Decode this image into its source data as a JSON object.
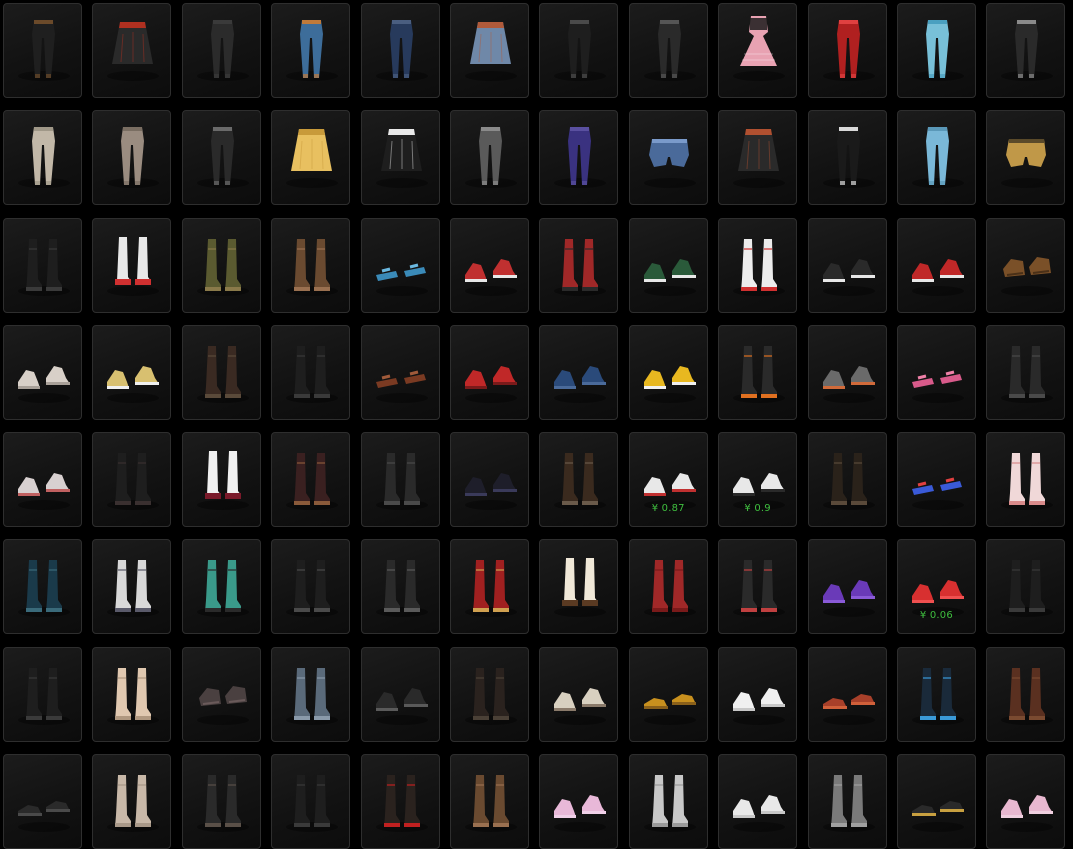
{
  "items": [
    {
      "name": "pants",
      "color": "#1f1f1f",
      "accent": "#6b4a2a"
    },
    {
      "name": "skirt",
      "color": "#2a2a2a",
      "accent": "#b03020"
    },
    {
      "name": "pants",
      "color": "#2b2b2b",
      "accent": "#3a3a3a"
    },
    {
      "name": "pants",
      "color": "#3d6d9a",
      "accent": "#c07a3a"
    },
    {
      "name": "pants",
      "color": "#273a5c",
      "accent": "#4a5e80"
    },
    {
      "name": "skirt",
      "color": "#6f88a8",
      "accent": "#b05a3a"
    },
    {
      "name": "pants",
      "color": "#1e1e1e",
      "accent": "#4a4a4a"
    },
    {
      "name": "pants",
      "color": "#2a2a2a",
      "accent": "#555555"
    },
    {
      "name": "dress",
      "color": "#e8a2b2",
      "accent": "#1c1c1c"
    },
    {
      "name": "pants",
      "color": "#b02020",
      "accent": "#e04040"
    },
    {
      "name": "pants",
      "color": "#78c0d8",
      "accent": "#4aa0c0"
    },
    {
      "name": "pants",
      "color": "#2a2a2a",
      "accent": "#8a8a8a"
    },
    {
      "name": "pants",
      "color": "#c2b8a8",
      "accent": "#a09888"
    },
    {
      "name": "pants",
      "color": "#9a8c80",
      "accent": "#7a6e62"
    },
    {
      "name": "pants",
      "color": "#2a2a2a",
      "accent": "#6a6a6a"
    },
    {
      "name": "skirt",
      "color": "#e8c060",
      "accent": "#c89a3a"
    },
    {
      "name": "skirt",
      "color": "#1e1e1e",
      "accent": "#e8e8e8"
    },
    {
      "name": "pants",
      "color": "#5a5a5a",
      "accent": "#8a8a8a"
    },
    {
      "name": "pants",
      "color": "#3a3280",
      "accent": "#5a50a0"
    },
    {
      "name": "shorts",
      "color": "#4a6a9a",
      "accent": "#7a9aca"
    },
    {
      "name": "skirt",
      "color": "#2a2a2a",
      "accent": "#b05030"
    },
    {
      "name": "pants",
      "color": "#1a1a1a",
      "accent": "#d8d8d8"
    },
    {
      "name": "pants",
      "color": "#7ab8d8",
      "accent": "#5a98b8"
    },
    {
      "name": "shorts",
      "color": "#c09848",
      "accent": "#5a4a2a"
    },
    {
      "name": "boots",
      "color": "#1e1e1e",
      "accent": "#3a3a3a"
    },
    {
      "name": "socks-shoes",
      "color": "#e8e8e8",
      "accent": "#d03030"
    },
    {
      "name": "boots",
      "color": "#5a5a30",
      "accent": "#8a7a4a"
    },
    {
      "name": "boots",
      "color": "#6a4a30",
      "accent": "#9a7050"
    },
    {
      "name": "sandals",
      "color": "#3a8ab8",
      "accent": "#6ab8e0"
    },
    {
      "name": "sneakers",
      "color": "#c03030",
      "accent": "#e8e8e8"
    },
    {
      "name": "boots",
      "color": "#a02828",
      "accent": "#2a2a2a"
    },
    {
      "name": "sneakers",
      "color": "#2a5a3a",
      "accent": "#e8e8e8"
    },
    {
      "name": "boots",
      "color": "#ececec",
      "accent": "#d03030"
    },
    {
      "name": "sneakers",
      "color": "#2a2a2a",
      "accent": "#e8e8e8"
    },
    {
      "name": "sneakers",
      "color": "#c02828",
      "accent": "#e8e8e8"
    },
    {
      "name": "gloves",
      "color": "#7a5028",
      "accent": "#4a3018"
    },
    {
      "name": "sneakers",
      "color": "#d8d0c8",
      "accent": "#a8a098"
    },
    {
      "name": "sneakers",
      "color": "#d8c070",
      "accent": "#f0f0f0"
    },
    {
      "name": "boots",
      "color": "#3a2a22",
      "accent": "#5a4a3a"
    },
    {
      "name": "boots",
      "color": "#1e1e1e",
      "accent": "#3a3a3a"
    },
    {
      "name": "sandals",
      "color": "#7a3a22",
      "accent": "#a05a3a"
    },
    {
      "name": "sneakers",
      "color": "#c02828",
      "accent": "#7a1a1a"
    },
    {
      "name": "sneakers",
      "color": "#2a4a7a",
      "accent": "#4a6a9a"
    },
    {
      "name": "sneakers",
      "color": "#e8b820",
      "accent": "#f0f0f0"
    },
    {
      "name": "boots",
      "color": "#2a2a2a",
      "accent": "#e07020"
    },
    {
      "name": "sneakers",
      "color": "#6a6a6a",
      "accent": "#d06a3a"
    },
    {
      "name": "sandals",
      "color": "#d85a8a",
      "accent": "#f080a8"
    },
    {
      "name": "boots",
      "color": "#2a2a2a",
      "accent": "#4a4a4a"
    },
    {
      "name": "sneakers",
      "color": "#d8d0d0",
      "accent": "#c06060"
    },
    {
      "name": "boots",
      "color": "#1e1e1e",
      "accent": "#3a3030"
    },
    {
      "name": "socks-shoes",
      "color": "#f0f0f0",
      "accent": "#7a1a2a"
    },
    {
      "name": "boots",
      "color": "#3a2020",
      "accent": "#8a5a3a"
    },
    {
      "name": "boots",
      "color": "#2a2a2a",
      "accent": "#4a4a4a"
    },
    {
      "name": "sneakers",
      "color": "#1e1e2a",
      "accent": "#3a3a5a"
    },
    {
      "name": "boots",
      "color": "#3a2a1e",
      "accent": "#6a5a4a"
    },
    {
      "name": "sneakers",
      "color": "#e8e8e8",
      "accent": "#c03030",
      "price": "¥ 0.87"
    },
    {
      "name": "sneakers",
      "color": "#e8e8e8",
      "accent": "#2a2a2a",
      "price": "¥ 0.9"
    },
    {
      "name": "boots",
      "color": "#2a221a",
      "accent": "#5a4a3a"
    },
    {
      "name": "sandals",
      "color": "#3a5ad8",
      "accent": "#e04040"
    },
    {
      "name": "boots",
      "color": "#f0d8d8",
      "accent": "#d88a8a"
    },
    {
      "name": "boots",
      "color": "#1a3a4a",
      "accent": "#3a6a7a"
    },
    {
      "name": "boots",
      "color": "#d8d8d8",
      "accent": "#5a5a6a"
    },
    {
      "name": "boots",
      "color": "#3a9a8a",
      "accent": "#2a2a2a"
    },
    {
      "name": "boots",
      "color": "#1e1e1e",
      "accent": "#4a4a4a"
    },
    {
      "name": "boots",
      "color": "#2a2a2a",
      "accent": "#5a5a5a"
    },
    {
      "name": "boots",
      "color": "#a02020",
      "accent": "#d0a050"
    },
    {
      "name": "socks-shoes",
      "color": "#f0e8d8",
      "accent": "#5a3a22"
    },
    {
      "name": "boots",
      "color": "#a02828",
      "accent": "#7a1a1a"
    },
    {
      "name": "boots",
      "color": "#2a2a2a",
      "accent": "#c04040"
    },
    {
      "name": "sneakers",
      "color": "#6a3ab8",
      "accent": "#8a5ad8"
    },
    {
      "name": "sneakers",
      "color": "#d83030",
      "accent": "#f05050",
      "price": "¥ 0.06"
    },
    {
      "name": "boots",
      "color": "#1e1e1e",
      "accent": "#3a3a3a"
    },
    {
      "name": "boots",
      "color": "#1e1e1e",
      "accent": "#3a3a3a"
    },
    {
      "name": "boots",
      "color": "#e0c8b0",
      "accent": "#b09880"
    },
    {
      "name": "gloves",
      "color": "#4a4040",
      "accent": "#6a5a5a"
    },
    {
      "name": "boots",
      "color": "#5a6a7a",
      "accent": "#8a9aaa"
    },
    {
      "name": "sneakers",
      "color": "#2a2a2a",
      "accent": "#5a5a5a"
    },
    {
      "name": "boots",
      "color": "#2a221e",
      "accent": "#4a4036"
    },
    {
      "name": "sneakers",
      "color": "#d8d0c0",
      "accent": "#8a7a6a"
    },
    {
      "name": "shoes",
      "color": "#c8901e",
      "accent": "#8a601a"
    },
    {
      "name": "sneakers",
      "color": "#f0f0f0",
      "accent": "#c8c8c8"
    },
    {
      "name": "shoes",
      "color": "#a8402a",
      "accent": "#d0603a"
    },
    {
      "name": "boots",
      "color": "#1a2a3a",
      "accent": "#3a9ad8"
    },
    {
      "name": "boots",
      "color": "#5a3020",
      "accent": "#7a4a30"
    },
    {
      "name": "shoes",
      "color": "#2a2a2a",
      "accent": "#4a4a4a"
    },
    {
      "name": "boots",
      "color": "#c8b8a8",
      "accent": "#a89888"
    },
    {
      "name": "boots",
      "color": "#2a2a2a",
      "accent": "#5a5048"
    },
    {
      "name": "boots",
      "color": "#1e1e1e",
      "accent": "#3a3a3a"
    },
    {
      "name": "boots",
      "color": "#2a221e",
      "accent": "#c02020"
    },
    {
      "name": "boots",
      "color": "#6a4a30",
      "accent": "#9a7050"
    },
    {
      "name": "sneakers",
      "color": "#e8b8d8",
      "accent": "#f0d0e8"
    },
    {
      "name": "boots",
      "color": "#c8c8c8",
      "accent": "#9a9a9a"
    },
    {
      "name": "sneakers",
      "color": "#e8e8e8",
      "accent": "#c8c8c8"
    },
    {
      "name": "boots",
      "color": "#7a7a7a",
      "accent": "#a0a0a0"
    },
    {
      "name": "shoes",
      "color": "#2a2a2a",
      "accent": "#c8a040"
    },
    {
      "name": "sneakers",
      "color": "#e8b8d0",
      "accent": "#f0d0e0"
    }
  ]
}
